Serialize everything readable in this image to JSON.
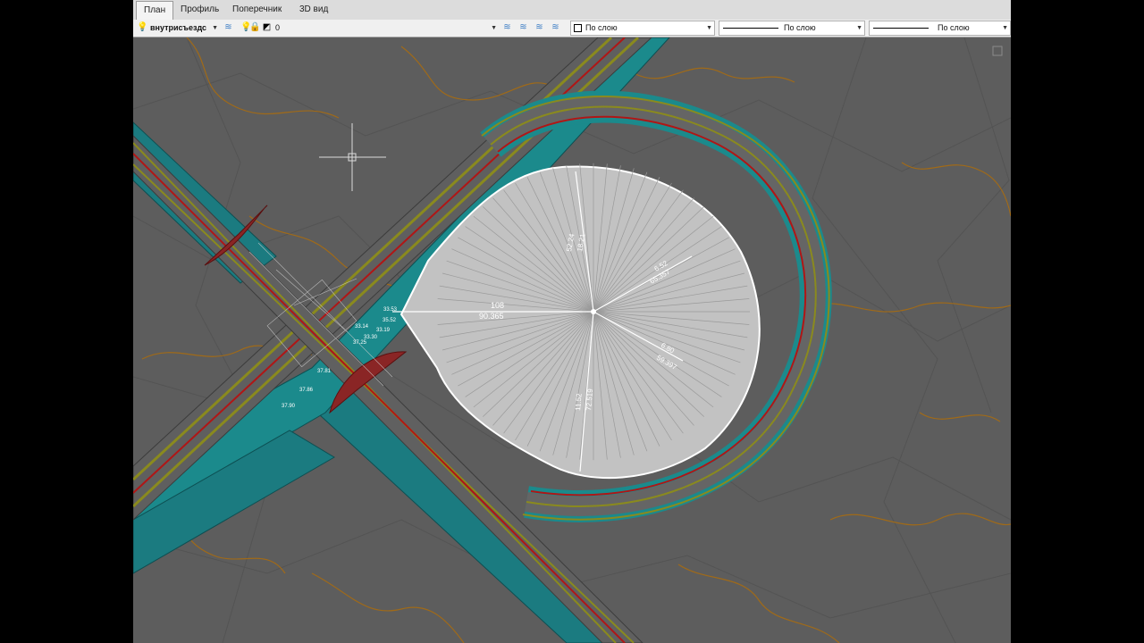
{
  "tabs": [
    {
      "label": "План",
      "active": true
    },
    {
      "label": "Профиль",
      "active": false
    },
    {
      "label": "Поперечник",
      "active": false
    },
    {
      "label": "3D вид",
      "active": false
    }
  ],
  "toolbar": {
    "layer_name": "внутрисъездс",
    "layer_value": "0",
    "color_value": "По слою",
    "linetype_value": "По слою",
    "lineweight_value": "По слою"
  },
  "drawing": {
    "dim_108": "108",
    "dim_90": "90.365",
    "dim_65": "65.357",
    "dim_59": "59.397",
    "dim_72": "72.519",
    "dim_52": "52.24",
    "dim_r1": "6.52",
    "dim_r2": "6.80",
    "dim_r3": "18.21",
    "dim_r4": "11.52",
    "elev": [
      "37.90",
      "37.86",
      "37.81",
      "37.25",
      "33.14",
      "33.30",
      "35.52",
      "33.19",
      "33.53"
    ]
  },
  "colors": {
    "terrain": "#5a5a5a",
    "road_teal": "#1f8d8f",
    "road_olive": "#8a8a1e",
    "road_red": "#b01616",
    "contour": "#a06a18",
    "disc": "#c8c8c8"
  }
}
